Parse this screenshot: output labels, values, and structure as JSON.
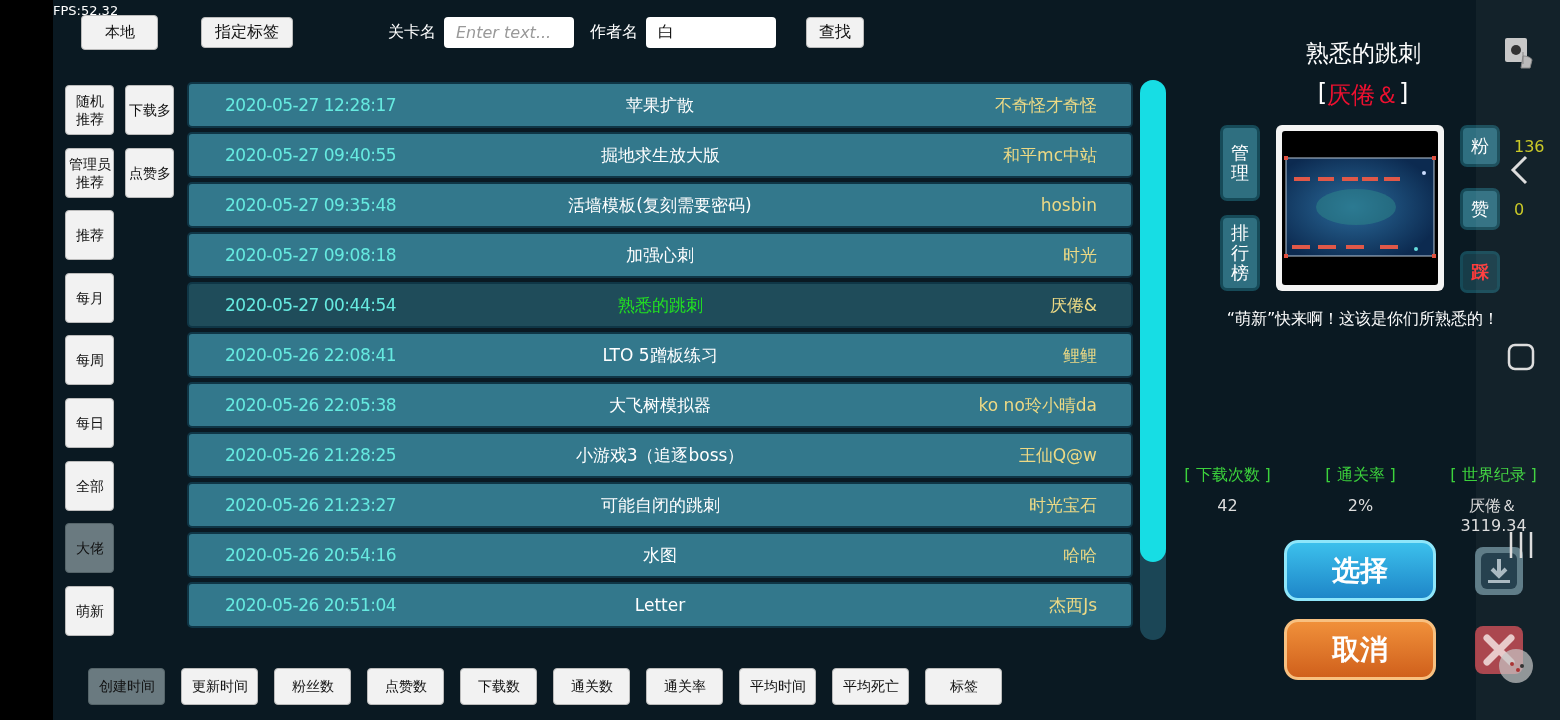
{
  "fps": "FPS:52.32",
  "top_bar": {
    "buttons": [
      {
        "label": "本地"
      },
      {
        "label": "指定标签"
      }
    ],
    "level_name": {
      "label": "关卡名",
      "placeholder": "Enter text..."
    },
    "author_name": {
      "label": "作者名",
      "value": "白"
    },
    "search_button": "查找"
  },
  "categories": {
    "column_1": [
      {
        "label": "随机推荐",
        "selected": false
      },
      {
        "label": "管理员推荐",
        "selected": false
      },
      {
        "label": "推荐",
        "selected": false
      },
      {
        "label": "每月",
        "selected": false
      },
      {
        "label": "每周",
        "selected": false
      },
      {
        "label": "每日",
        "selected": false
      },
      {
        "label": "全部",
        "selected": false
      },
      {
        "label": "大佬",
        "selected": true
      },
      {
        "label": "萌新",
        "selected": false
      }
    ],
    "column_2": [
      {
        "label": "下载多",
        "selected": false
      },
      {
        "label": "点赞多",
        "selected": false
      }
    ]
  },
  "levels": [
    {
      "date": "2020-05-27 12:28:17",
      "title": "苹果扩散",
      "author": "不奇怪才奇怪",
      "selected": false
    },
    {
      "date": "2020-05-27 09:40:55",
      "title": "掘地求生放大版",
      "author": "和平mc中站",
      "selected": false
    },
    {
      "date": "2020-05-27 09:35:48",
      "title": "活墙模板(复刻需要密码)",
      "author": "hosbin",
      "selected": false
    },
    {
      "date": "2020-05-27 09:08:18",
      "title": "加强心刺",
      "author": "时光",
      "selected": false
    },
    {
      "date": "2020-05-27 00:44:54",
      "title": "熟悉的跳刺",
      "author": "厌倦&",
      "selected": true
    },
    {
      "date": "2020-05-26 22:08:41",
      "title": "LTO 5蹭板练习",
      "author": "鲤鲤",
      "selected": false
    },
    {
      "date": "2020-05-26 22:05:38",
      "title": "大飞树模拟器",
      "author": "ko no玲小晴da",
      "selected": false
    },
    {
      "date": "2020-05-26 21:28:25",
      "title": "小游戏3（追逐boss）",
      "author": "王仙Q@w",
      "selected": false
    },
    {
      "date": "2020-05-26 21:23:27",
      "title": "可能自闭的跳刺",
      "author": "时光宝石",
      "selected": false
    },
    {
      "date": "2020-05-26 20:54:16",
      "title": "水图",
      "author": "哈哈",
      "selected": false
    },
    {
      "date": "2020-05-26 20:51:04",
      "title": "Letter",
      "author": "杰西Js",
      "selected": false
    }
  ],
  "sort_buttons": [
    {
      "label": "创建时间",
      "selected": true
    },
    {
      "label": "更新时间",
      "selected": false
    },
    {
      "label": "粉丝数",
      "selected": false
    },
    {
      "label": "点赞数",
      "selected": false
    },
    {
      "label": "下载数",
      "selected": false
    },
    {
      "label": "通关数",
      "selected": false
    },
    {
      "label": "通关率",
      "selected": false
    },
    {
      "label": "平均时间",
      "selected": false
    },
    {
      "label": "平均死亡",
      "selected": false
    },
    {
      "label": "标签",
      "selected": false
    }
  ],
  "detail": {
    "title": "熟悉的跳刺",
    "author": {
      "open": "[",
      "name": "厌倦＆",
      "close": "]"
    },
    "left_buttons": [
      {
        "label": "管理"
      },
      {
        "label": "排行榜"
      }
    ],
    "right_buttons": [
      {
        "label": "粉",
        "count": "136",
        "kind": "fans"
      },
      {
        "label": "赞",
        "count": "0",
        "kind": "like"
      },
      {
        "label": "踩",
        "kind": "dislike"
      }
    ],
    "description": "“萌新”快来啊！这该是你们所熟悉的！",
    "stats": [
      {
        "label": "[ 下载次数 ]",
        "value": "42"
      },
      {
        "label": "[ 通关率 ]",
        "value": "2%"
      },
      {
        "label": "[ 世界纪录 ]",
        "value": "厌倦＆\n3119.34"
      }
    ],
    "select_button": "选择",
    "cancel_button": "取消"
  }
}
